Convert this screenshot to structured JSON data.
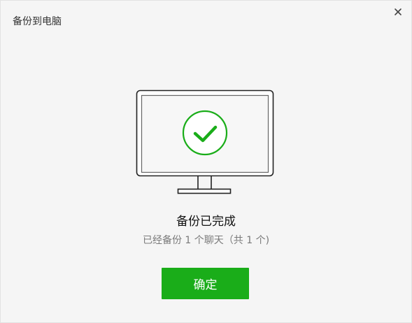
{
  "window": {
    "title": "备份到电脑",
    "close_icon": "close-icon"
  },
  "illustration": {
    "icon": "monitor-check-icon",
    "accent_color": "#1aad19"
  },
  "status": {
    "title": "备份已完成",
    "subtitle": "已经备份 1 个聊天（共 1 个)"
  },
  "actions": {
    "confirm_label": "确定",
    "confirm_color": "#1aad19"
  }
}
